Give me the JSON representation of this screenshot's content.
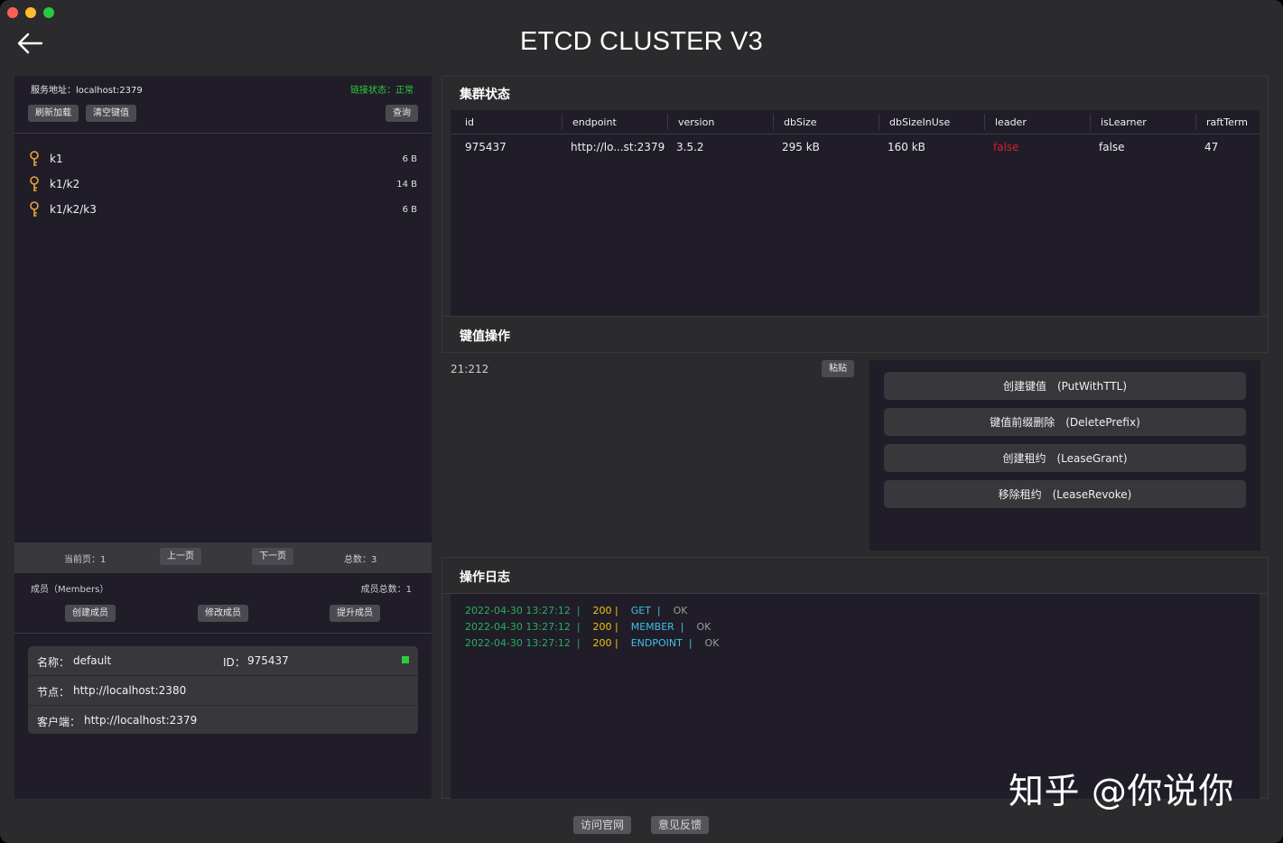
{
  "window": {
    "title": "ETCD CLUSTER V3"
  },
  "connection": {
    "address_label": "服务地址：",
    "address": "localhost:2379",
    "status_label": "链接状态：",
    "status": "正常"
  },
  "toolbar": {
    "refresh_label": "刷新加载",
    "clear_label": "清空键值",
    "query_label": "查询"
  },
  "keys": [
    {
      "name": "k1",
      "size": "6 B"
    },
    {
      "name": "k1/k2",
      "size": "14 B"
    },
    {
      "name": "k1/k2/k3",
      "size": "6 B"
    }
  ],
  "pager": {
    "current_label": "当前页：",
    "current": "1",
    "prev_label": "上一页",
    "next_label": "下一页",
    "total_label": "总数：",
    "total": "3"
  },
  "members": {
    "header": "成员（Members）",
    "count_label": "成员总数：",
    "count": "1",
    "create_label": "创建成员",
    "modify_label": "修改成员",
    "promote_label": "提升成员",
    "card": {
      "name_label": "名称：",
      "name": "default",
      "id_label": "ID：",
      "id": "975437",
      "peer_label": "节点：",
      "peer": "http://localhost:2380",
      "client_label": "客户端：",
      "client": "http://localhost:2379"
    }
  },
  "cluster": {
    "title": "集群状态",
    "columns": [
      "id",
      "endpoint",
      "version",
      "dbSize",
      "dbSizeInUse",
      "leader",
      "isLearner",
      "raftTerm"
    ],
    "row": [
      "975437",
      "http://lo...st:2379",
      "3.5.2",
      "295 kB",
      "160 kB",
      "false",
      "false",
      "47"
    ]
  },
  "kv": {
    "title": "键值操作",
    "input_text": "21:212",
    "paste_label": "粘贴",
    "ops": [
      "创建键值　(PutWithTTL)",
      "键值前缀删除　(DeletePrefix)",
      "创建租约　(LeaseGrant)",
      "移除租约　(LeaseRevoke)"
    ]
  },
  "log": {
    "title": "操作日志",
    "lines": [
      {
        "time": "2022-04-30 13:27:12",
        "code": "200",
        "method": "GET",
        "result": "OK"
      },
      {
        "time": "2022-04-30 13:27:12",
        "code": "200",
        "method": "MEMBER",
        "result": "OK"
      },
      {
        "time": "2022-04-30 13:27:12",
        "code": "200",
        "method": "ENDPOINT",
        "result": "OK"
      }
    ]
  },
  "footer": {
    "website_label": "访问官网",
    "feedback_label": "意见反馈"
  },
  "watermark": "知乎 @你说你",
  "colors": {
    "status_ok": "#2ecc40",
    "leader_false": "#d0202a",
    "log_time": "#27ae60",
    "log_code": "#f1c40f",
    "log_method": "#3ec0e6"
  }
}
